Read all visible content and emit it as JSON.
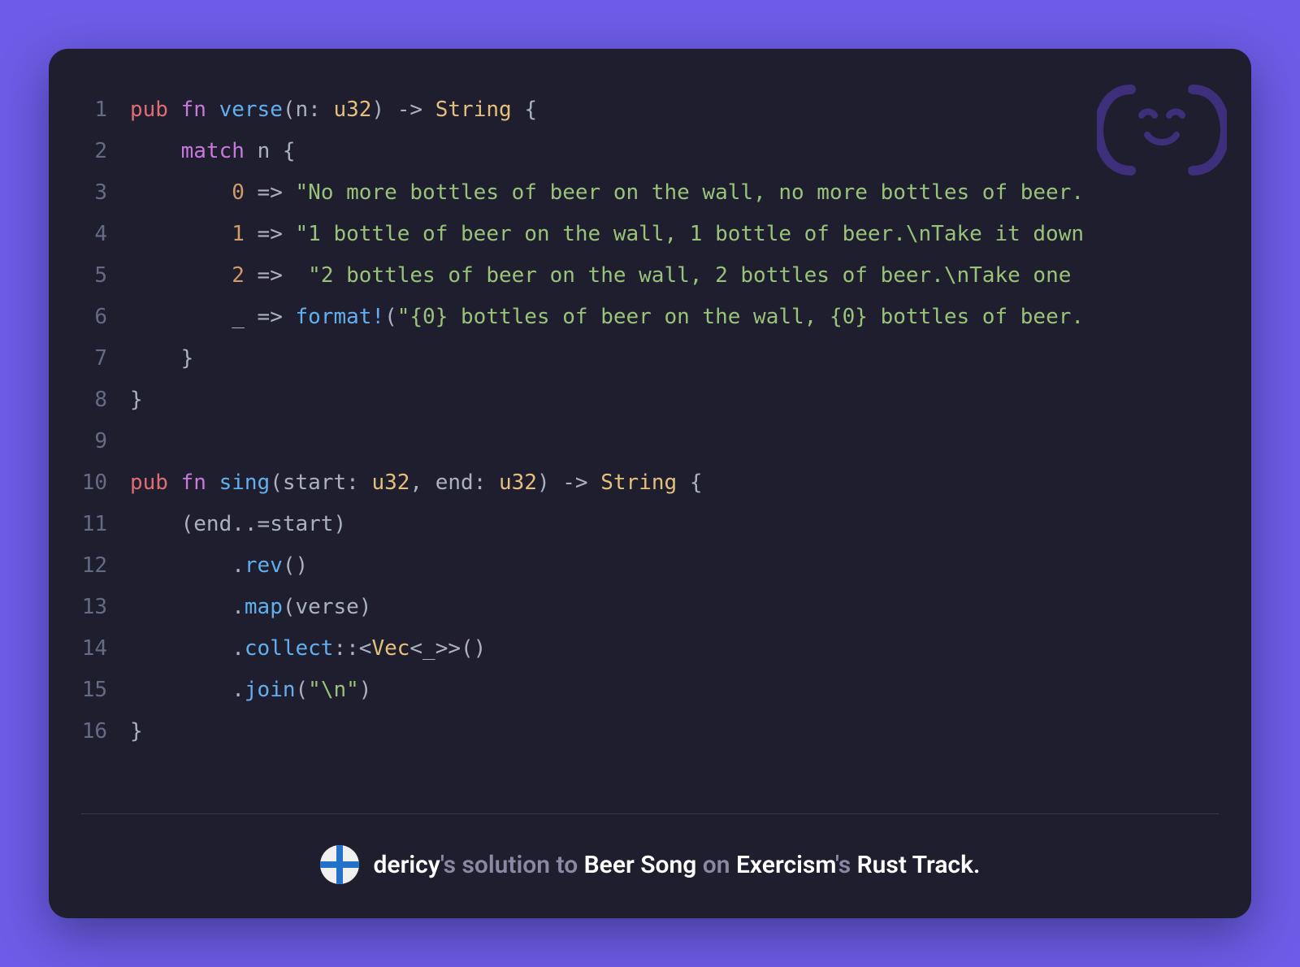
{
  "code": {
    "lines": [
      {
        "n": "1",
        "html": "<span class='kw-red'>pub</span> <span class='kw-purple'>fn</span> <span class='fn-blue'>verse</span><span class='punct'>(n: </span><span class='type'>u32</span><span class='punct'>)</span> <span class='punct'>-&gt;</span> <span class='type'>String</span> <span class='punct'>{</span>"
      },
      {
        "n": "2",
        "html": "    <span class='kw-purple'>match</span> <span class='muted'>n</span> <span class='punct'>{</span>"
      },
      {
        "n": "3",
        "html": "        <span class='num'>0</span> <span class='punct'>=&gt;</span> <span class='str'>\"No more bottles of beer on the wall, no more bottles of beer.</span>"
      },
      {
        "n": "4",
        "html": "        <span class='num'>1</span> <span class='punct'>=&gt;</span> <span class='str'>\"1 bottle of beer on the wall, 1 bottle of beer.\\nTake it down</span>"
      },
      {
        "n": "5",
        "html": "        <span class='num'>2</span> <span class='punct'>=&gt;</span>  <span class='str'>\"2 bottles of beer on the wall, 2 bottles of beer.\\nTake one </span>"
      },
      {
        "n": "6",
        "html": "        <span class='punct'>_</span> <span class='punct'>=&gt;</span> <span class='fn-blue'>format!</span><span class='punct'>(</span><span class='str'>\"{0} bottles of beer on the wall, {0} bottles of beer.</span>"
      },
      {
        "n": "7",
        "html": "    <span class='punct'>}</span>"
      },
      {
        "n": "8",
        "html": "<span class='punct'>}</span>"
      },
      {
        "n": "9",
        "html": ""
      },
      {
        "n": "10",
        "html": "<span class='kw-red'>pub</span> <span class='kw-purple'>fn</span> <span class='fn-blue'>sing</span><span class='punct'>(start: </span><span class='type'>u32</span><span class='punct'>, end: </span><span class='type'>u32</span><span class='punct'>)</span> <span class='punct'>-&gt;</span> <span class='type'>String</span> <span class='punct'>{</span>"
      },
      {
        "n": "11",
        "html": "    <span class='punct'>(end..=start)</span>"
      },
      {
        "n": "12",
        "html": "        <span class='punct'>.</span><span class='fn-blue'>rev</span><span class='punct'>()</span>"
      },
      {
        "n": "13",
        "html": "        <span class='punct'>.</span><span class='fn-blue'>map</span><span class='punct'>(verse)</span>"
      },
      {
        "n": "14",
        "html": "        <span class='punct'>.</span><span class='fn-blue'>collect</span><span class='punct'>::&lt;</span><span class='type'>Vec</span><span class='punct'>&lt;_&gt;&gt;()</span>"
      },
      {
        "n": "15",
        "html": "        <span class='punct'>.</span><span class='fn-blue'>join</span><span class='punct'>(</span><span class='str'>\"\\n\"</span><span class='punct'>)</span>"
      },
      {
        "n": "16",
        "html": "<span class='punct'>}</span>"
      }
    ]
  },
  "footer": {
    "author": "dericy",
    "poss": "'s ",
    "solution_to": "solution to ",
    "exercise": "Beer Song",
    "on": " on ",
    "site": "Exercism",
    "poss2": "'s ",
    "track": "Rust Track."
  }
}
